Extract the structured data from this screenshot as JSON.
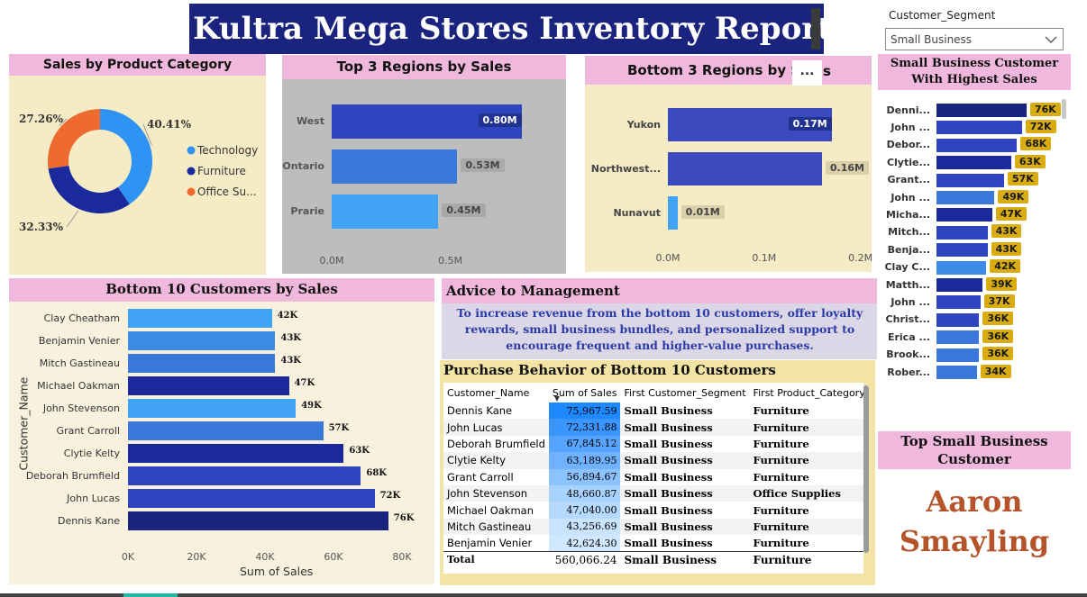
{
  "title": "Kultra Mega Stores Inventory Report",
  "slicer": {
    "label": "Customer_Segment",
    "selected": "Small Business"
  },
  "category_chart": {
    "title": "Sales by Product Category",
    "legend": [
      "Technology",
      "Furniture",
      "Office Su..."
    ],
    "data_labels": [
      "40.41%",
      "32.33%",
      "27.26%"
    ],
    "colors": [
      "#2e93f2",
      "#1a2a9c",
      "#ee6a2f"
    ],
    "chart_data": {
      "type": "pie",
      "categories": [
        "Technology",
        "Furniture",
        "Office Supplies"
      ],
      "values": [
        40.41,
        32.33,
        27.26
      ]
    }
  },
  "top_regions": {
    "title": "Top 3 Regions by Sales",
    "ticks": [
      "0.0M",
      "0.5M"
    ],
    "categories": [
      "West",
      "Ontario",
      "Prarie"
    ],
    "labels": [
      "0.80M",
      "0.53M",
      "0.45M"
    ],
    "colors": [
      "#2f45c0",
      "#3a78dc",
      "#41a3f4"
    ],
    "chart_data": {
      "type": "bar",
      "categories": [
        "West",
        "Ontario",
        "Prarie"
      ],
      "values": [
        0.8,
        0.53,
        0.45
      ],
      "xlim": [
        0,
        0.95
      ]
    }
  },
  "bottom_regions": {
    "title": "Bottom 3 Regions by S",
    "title_tail": "s",
    "more_label": "...",
    "ticks": [
      "0.0M",
      "0.1M",
      "0.2M"
    ],
    "categories": [
      "Yukon",
      "Northwest...",
      "Nunavut"
    ],
    "labels": [
      "0.17M",
      "0.16M",
      "0.01M"
    ],
    "colors": [
      "#3b4bbf",
      "#3b4bbf",
      "#41a3f4"
    ],
    "chart_data": {
      "type": "bar",
      "categories": [
        "Yukon",
        "Northwest...",
        "Nunavut"
      ],
      "values": [
        0.17,
        0.16,
        0.01
      ],
      "xlim": [
        0,
        0.22
      ]
    }
  },
  "top_customers": {
    "title": "Small Business Customer With Highest Sales",
    "categories": [
      "Denni...",
      "John ...",
      "Debor...",
      "Clytie...",
      "Grant...",
      "John ...",
      "Micha...",
      "Mitch...",
      "Benja...",
      "Clay C...",
      "Matth...",
      "John ...",
      "Christ...",
      "Erica ...",
      "Brook...",
      "Rober..."
    ],
    "labels": [
      "76K",
      "72K",
      "68K",
      "63K",
      "57K",
      "49K",
      "47K",
      "43K",
      "43K",
      "42K",
      "39K",
      "37K",
      "36K",
      "36K",
      "36K",
      "34K"
    ],
    "colors": [
      "#1a237e",
      "#2f45c0",
      "#2f45c0",
      "#1a2a9c",
      "#2f45c0",
      "#3a78dc",
      "#1a2a9c",
      "#2f45c0",
      "#2f45c0",
      "#3a8ae6",
      "#1a2a9c",
      "#2f45c0",
      "#2f45c0",
      "#3a78dc",
      "#3a78dc",
      "#3a78dc"
    ],
    "chart_data": {
      "type": "bar",
      "categories": [
        "Denni...",
        "John ...",
        "Debor...",
        "Clytie...",
        "Grant...",
        "John ...",
        "Micha...",
        "Mitch...",
        "Benja...",
        "Clay C...",
        "Matth...",
        "John ...",
        "Christ...",
        "Erica ...",
        "Brook...",
        "Rober..."
      ],
      "values": [
        76,
        72,
        68,
        63,
        57,
        49,
        47,
        43,
        43,
        42,
        39,
        37,
        36,
        36,
        36,
        34
      ]
    }
  },
  "bottom_customers": {
    "title": "Bottom 10 Customers by Sales",
    "xlabel": "Sum of Sales",
    "ylabel": "Customer_Name",
    "ticks": [
      "0K",
      "20K",
      "40K",
      "60K",
      "80K"
    ],
    "categories": [
      "Clay Cheatham",
      "Benjamin Venier",
      "Mitch Gastineau",
      "Michael Oakman",
      "John Stevenson",
      "Grant Carroll",
      "Clytie Kelty",
      "Deborah Brumfield",
      "John Lucas",
      "Dennis Kane"
    ],
    "labels": [
      "42K",
      "43K",
      "43K",
      "47K",
      "49K",
      "57K",
      "63K",
      "68K",
      "72K",
      "76K"
    ],
    "colors": [
      "#41a3f4",
      "#3a8ae6",
      "#3a78dc",
      "#1a2a9c",
      "#41a3f4",
      "#3a78dc",
      "#1a2a9c",
      "#2f45c0",
      "#2f45c0",
      "#1a237e"
    ],
    "chart_data": {
      "type": "bar",
      "categories": [
        "Clay Cheatham",
        "Benjamin Venier",
        "Mitch Gastineau",
        "Michael Oakman",
        "John Stevenson",
        "Grant Carroll",
        "Clytie Kelty",
        "Deborah Brumfield",
        "John Lucas",
        "Dennis Kane"
      ],
      "values": [
        42,
        43,
        43,
        47,
        49,
        57,
        63,
        68,
        72,
        76
      ],
      "xlabel": "Sum of Sales",
      "ylabel": "Customer_Name",
      "xlim": [
        0,
        80
      ]
    }
  },
  "advice": {
    "title": "Advice to Management",
    "text": "To increase revenue from the bottom 10 customers, offer loyalty rewards, small business bundles, and personalized support to encourage frequent and higher-value purchases."
  },
  "purchase_table": {
    "title": "Purchase Behavior of Bottom 10 Customers",
    "headers": [
      "Customer_Name",
      "Sum of Sales",
      "First Customer_Segment",
      "First Product_Category"
    ],
    "rows": [
      [
        "Dennis Kane",
        "75,967.59",
        "Small Business",
        "Furniture"
      ],
      [
        "John Lucas",
        "72,331.88",
        "Small Business",
        "Furniture"
      ],
      [
        "Deborah Brumfield",
        "67,845.12",
        "Small Business",
        "Furniture"
      ],
      [
        "Clytie Kelty",
        "63,189.95",
        "Small Business",
        "Furniture"
      ],
      [
        "Grant Carroll",
        "56,894.67",
        "Small Business",
        "Furniture"
      ],
      [
        "John Stevenson",
        "48,660.87",
        "Small Business",
        "Office Supplies"
      ],
      [
        "Michael Oakman",
        "47,040.00",
        "Small Business",
        "Furniture"
      ],
      [
        "Mitch Gastineau",
        "43,256.69",
        "Small Business",
        "Furniture"
      ],
      [
        "Benjamin Venier",
        "42,624.30",
        "Small Business",
        "Furniture"
      ]
    ],
    "cell_colors": [
      "#1e88ff",
      "#3a95ff",
      "#56a4ff",
      "#6fb2ff",
      "#8cc3ff",
      "#a9d3ff",
      "#b6daff",
      "#c9e4ff",
      "#cfe7ff"
    ],
    "total": [
      "Total",
      "560,066.24",
      "Small Business",
      "Furniture"
    ]
  },
  "top_customer_card": {
    "title": "Top Small Business Customer",
    "name": "Aaron Smayling"
  }
}
